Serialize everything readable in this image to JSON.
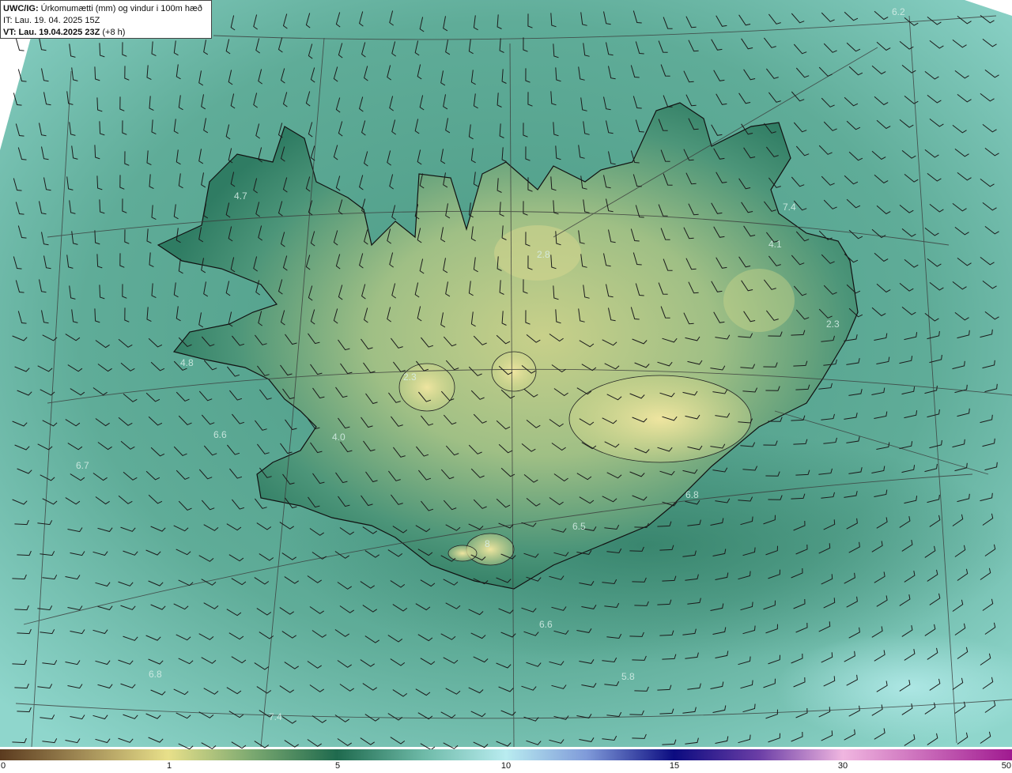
{
  "header": {
    "model": "UWC/IG:",
    "title": "Úrkomumætti (mm) og vindur i 100m hæð",
    "issue_time": "IT: Lau. 19. 04. 2025 15Z",
    "valid_time_bold": "VT: Lau. 19.04.2025 23Z",
    "valid_time_offset": "(+8 h)"
  },
  "value_labels": [
    {
      "text": "6.2",
      "name": "value-label-ne-corner"
    },
    {
      "text": "4.7",
      "name": "value-label-westfjords"
    },
    {
      "text": "7.4",
      "name": "value-label-northeast"
    },
    {
      "text": "4.1",
      "name": "value-label-east-highlands"
    },
    {
      "text": "2.8",
      "name": "value-label-north-central"
    },
    {
      "text": "2.3",
      "name": "value-label-eastfjords"
    },
    {
      "text": "4.8",
      "name": "value-label-snaefellsnes"
    },
    {
      "text": "2.3",
      "name": "value-label-langjokull"
    },
    {
      "text": "6.6",
      "name": "value-label-faxafloi"
    },
    {
      "text": "4.0",
      "name": "value-label-reykjavik"
    },
    {
      "text": "6.7",
      "name": "value-label-west-sea"
    },
    {
      "text": "6.8",
      "name": "value-label-southeast-coast"
    },
    {
      "text": "6.5",
      "name": "value-label-south-coast"
    },
    {
      "text": "6.6",
      "name": "value-label-south-sea"
    },
    {
      "text": "6.8",
      "name": "value-label-southwest-sea"
    },
    {
      "text": "5.8",
      "name": "value-label-south-far-sea"
    },
    {
      "text": "7.4",
      "name": "value-label-bottom-sea"
    },
    {
      "text": "8",
      "name": "value-label-myrdalsjokull"
    }
  ],
  "colorbar": {
    "ticks": [
      "0",
      "1",
      "5",
      "10",
      "15",
      "30",
      "50"
    ],
    "stops": [
      "#5b3b1f",
      "#a08a55",
      "#e8e08a",
      "#1f6a4e",
      "#6fbba9",
      "#b9ecf0",
      "#7f9ad9",
      "#0b0b80",
      "#6b3ea6",
      "#f0b6e0",
      "#a01a90"
    ]
  },
  "colors": {
    "sea": "#5fa895",
    "land_low": "#3f8c70",
    "land_high": "#c9d58a",
    "coastline": "#111111",
    "wind_barb": "#1b1b1b"
  }
}
